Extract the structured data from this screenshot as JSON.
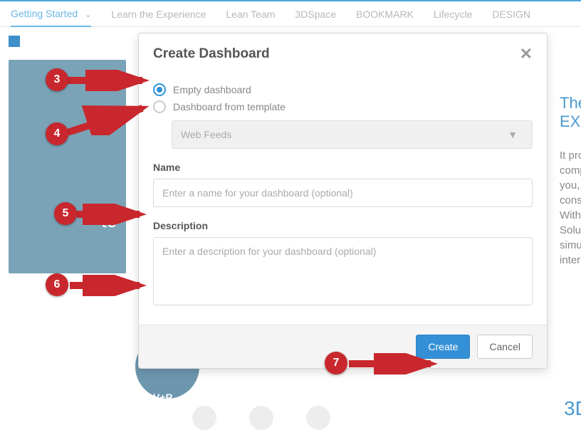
{
  "tabs": {
    "t0": "Getting Started",
    "t1": "Learn the Experience",
    "t2": "Lean Team",
    "t3": "3DSpace",
    "t4": "BOOKMARK",
    "t5": "Lifecycle",
    "t6": "DESIGN"
  },
  "modal": {
    "title": "Create Dashboard",
    "radio_empty": "Empty dashboard",
    "radio_template": "Dashboard from template",
    "dd_value": "Web Feeds",
    "name_label": "Name",
    "name_placeholder": "Enter a name for your dashboard (optional)",
    "desc_label": "Description",
    "desc_placeholder": "Enter a description for your dashboard (optional)",
    "btn_create": "Create",
    "btn_cancel": "Cancel"
  },
  "markers": {
    "m3": "3",
    "m4": "4",
    "m5": "5",
    "m6": "6",
    "m7": "7"
  },
  "bg": {
    "r1": "The",
    "r2": "EXP",
    "para": "It pro\ncomp\nyou,\ncons\nWith\nSolu\nsimu\ninter",
    "r3d": "3D",
    "vplus": "V+R",
    "tc": "tc"
  }
}
